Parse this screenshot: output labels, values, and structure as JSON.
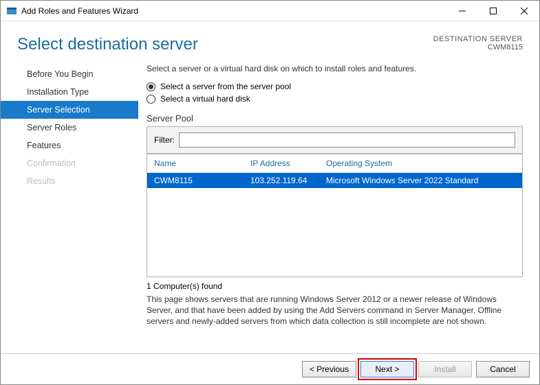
{
  "titlebar": {
    "title": "Add Roles and Features Wizard"
  },
  "header": {
    "page_title": "Select destination server",
    "dest_label": "DESTINATION SERVER",
    "dest_value": "CWM8115"
  },
  "sidebar": {
    "steps": [
      {
        "label": "Before You Begin",
        "state": "normal"
      },
      {
        "label": "Installation Type",
        "state": "normal"
      },
      {
        "label": "Server Selection",
        "state": "active"
      },
      {
        "label": "Server Roles",
        "state": "normal"
      },
      {
        "label": "Features",
        "state": "normal"
      },
      {
        "label": "Confirmation",
        "state": "disabled"
      },
      {
        "label": "Results",
        "state": "disabled"
      }
    ]
  },
  "main": {
    "intro": "Select a server or a virtual hard disk on which to install roles and features.",
    "radio_pool": "Select a server from the server pool",
    "radio_vhd": "Select a virtual hard disk",
    "section_label": "Server Pool",
    "filter_label": "Filter:",
    "filter_value": "",
    "columns": {
      "name": "Name",
      "ip": "IP Address",
      "os": "Operating System"
    },
    "rows": [
      {
        "name": "CWM8115",
        "ip": "103.252.119.64",
        "os": "Microsoft Windows Server 2022 Standard",
        "selected": true
      }
    ],
    "count_text": "1 Computer(s) found",
    "description": "This page shows servers that are running Windows Server 2012 or a newer release of Windows Server, and that have been added by using the Add Servers command in Server Manager. Offline servers and newly-added servers from which data collection is still incomplete are not shown."
  },
  "buttons": {
    "previous": "< Previous",
    "next": "Next >",
    "install": "Install",
    "cancel": "Cancel"
  }
}
